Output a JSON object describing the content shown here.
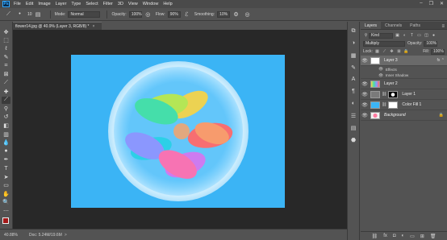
{
  "app": {
    "logo": "Ps",
    "menu": [
      "File",
      "Edit",
      "Image",
      "Layer",
      "Type",
      "Select",
      "Filter",
      "3D",
      "View",
      "Window",
      "Help"
    ],
    "window_controls": [
      "–",
      "❐",
      "✕"
    ]
  },
  "options": {
    "brush_size": "10",
    "mode_label": "Mode:",
    "mode_value": "Normal",
    "opacity_label": "Opacity:",
    "opacity_value": "100%",
    "flow_label": "Flow:",
    "flow_value": "90%",
    "smoothing_label": "Smoothing:",
    "smoothing_value": "10%"
  },
  "document": {
    "tab_title": "flower14.jpg @ 40.9% (Layer 3, RGB/8) *",
    "tab_close": "×",
    "canvas_color": "#3bb4f5"
  },
  "status": {
    "zoom": "40.88%",
    "doc_size": "Doc: 5.24M/19.6M",
    "arrow": ">"
  },
  "colors": {
    "foreground": "#a31818",
    "background": "#000000"
  },
  "layers_panel": {
    "tabs": [
      "Layers",
      "Channels",
      "Paths"
    ],
    "filter_value": "Kind",
    "blend_mode": "Multiply",
    "opacity_label": "Opacity:",
    "opacity_value": "100%",
    "lock_label": "Lock:",
    "fill_label": "Fill:",
    "fill_value": "100%",
    "layers": [
      {
        "name": "Layer 3",
        "selected": true
      },
      {
        "name": "Layer 2",
        "selected": false
      },
      {
        "name": "Layer 1",
        "selected": false
      },
      {
        "name": "Color Fill 1",
        "selected": false
      },
      {
        "name": "Background",
        "selected": false
      }
    ],
    "effects_label": "Effects",
    "effect_item": "Inner Shadow",
    "footer_icons": [
      "link-icon",
      "fx-icon",
      "mask-icon",
      "adjustment-icon",
      "folder-icon",
      "new-layer-icon",
      "trash-icon"
    ],
    "footer_glyphs": [
      "⛓",
      "fx",
      "◘",
      "◐",
      "▭",
      "⊞",
      "🗑"
    ]
  }
}
